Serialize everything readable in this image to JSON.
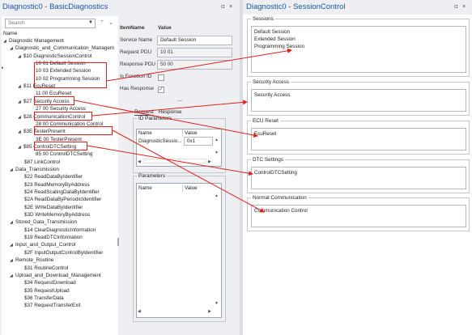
{
  "left_window": {
    "title": "Diagnostic0 - BasicDiagnostics",
    "pin_icon": "pin-icon",
    "close_icon": "×",
    "search": {
      "placeholder": "Search"
    },
    "tree_header": "Name",
    "tree": [
      {
        "label": "Diagnostic Management",
        "level": 0,
        "expander": "◢"
      },
      {
        "label": "Diagnostic_and_Communication_Managem",
        "level": 1,
        "expander": "◢"
      },
      {
        "label": "$10 DiagnosticSessionControl",
        "level": 2,
        "expander": "◢"
      },
      {
        "label": "10 01 Default Session",
        "level": 3,
        "expander": ""
      },
      {
        "label": "10 03 Extended Session",
        "level": 3,
        "expander": ""
      },
      {
        "label": "10 02 Programming Session",
        "level": 3,
        "expander": ""
      },
      {
        "label": "$11 EcuReset",
        "level": 2,
        "expander": "◢"
      },
      {
        "label": "11 00 EcuReset",
        "level": 3,
        "expander": ""
      },
      {
        "label": "$27 Security Access",
        "level": 2,
        "expander": "◢"
      },
      {
        "label": "27 00 Security Access",
        "level": 3,
        "expander": ""
      },
      {
        "label": "$28 CommunicationControl",
        "level": 2,
        "expander": "◢"
      },
      {
        "label": "28 00 Communication Control",
        "level": 3,
        "expander": ""
      },
      {
        "label": "$3E TesterPresent",
        "level": 2,
        "expander": "◢"
      },
      {
        "label": "3E 00 TesterPresent",
        "level": 3,
        "expander": ""
      },
      {
        "label": "$85 ControlDTCSetting",
        "level": 2,
        "expander": "◢"
      },
      {
        "label": "85 00 ControlDTCSetting",
        "level": 3,
        "expander": ""
      },
      {
        "label": "$87 LinkControl",
        "level": 2,
        "expander": ""
      },
      {
        "label": "Data_Transmission",
        "level": 1,
        "expander": "◢"
      },
      {
        "label": "$22 ReadDataByIdentifier",
        "level": 2,
        "expander": ""
      },
      {
        "label": "$23 ReadMemoryByAddress",
        "level": 2,
        "expander": ""
      },
      {
        "label": "$24 ReadScalingDataByIdentifier",
        "level": 2,
        "expander": ""
      },
      {
        "label": "$2A ReadDataByPeriodicIdentifier",
        "level": 2,
        "expander": ""
      },
      {
        "label": "$2E WriteDataByIdentifier",
        "level": 2,
        "expander": ""
      },
      {
        "label": "$3D WriteMemoryByAddress",
        "level": 2,
        "expander": ""
      },
      {
        "label": "Stored_Data_Transmission",
        "level": 1,
        "expander": "◢"
      },
      {
        "label": "$14 ClearDiagnosticInformation",
        "level": 2,
        "expander": ""
      },
      {
        "label": "$19 ReadDTCInformation",
        "level": 2,
        "expander": ""
      },
      {
        "label": "Input_and_Output_Control",
        "level": 1,
        "expander": "◢"
      },
      {
        "label": "$2F InputOutputControlByIdentifier",
        "level": 2,
        "expander": ""
      },
      {
        "label": "Remote_Routine",
        "level": 1,
        "expander": "◢"
      },
      {
        "label": "$31 RoutineControl",
        "level": 2,
        "expander": ""
      },
      {
        "label": "Upload_and_Download_Management",
        "level": 1,
        "expander": "◢"
      },
      {
        "label": "$34 RequestDownload",
        "level": 2,
        "expander": ""
      },
      {
        "label": "$35 RequestUpload",
        "level": 2,
        "expander": ""
      },
      {
        "label": "$36 TransferData",
        "level": 2,
        "expander": ""
      },
      {
        "label": "$37 RequestTransferExit",
        "level": 2,
        "expander": ""
      }
    ],
    "props": {
      "col_itemname": "ItemName",
      "col_value": "Value",
      "service_name_label": "Service Name",
      "service_name_value": "Default Session",
      "request_pdu_label": "Request PDU",
      "request_pdu_value": "10 01",
      "response_pdu_label": "Response PDU",
      "response_pdu_value": "50 00",
      "is_function_id_label": "Is Function ID",
      "is_function_id_checked": false,
      "has_response_label": "Has Response",
      "has_response_checked": true,
      "dash": "—",
      "tab_request": "Request",
      "tab_response": "Response",
      "id_params_legend": "ID Parameters",
      "id_params_col_name": "Name",
      "id_params_col_value": "Value",
      "id_params_row_name": "DiagnosticSessio...",
      "id_params_row_value": "0x1",
      "params_legend": "Parameters",
      "params_col_name": "Name",
      "params_col_value": "Value"
    }
  },
  "right_window": {
    "title": "Diagnostic0 - SessionControl",
    "pin_icon": "pin-icon",
    "close_icon": "×",
    "groups": [
      {
        "legend": "Sessions",
        "items": [
          "Default Session",
          "Extended Session",
          "Programming Session"
        ]
      },
      {
        "legend": "Security Access",
        "items": [
          "Security Access"
        ]
      },
      {
        "legend": "ECU Reset",
        "items": [
          "EcuReset"
        ]
      },
      {
        "legend": "DTC Settings",
        "items": [
          "ControlDTCSetting"
        ]
      },
      {
        "legend": "Normal Communication",
        "items": [
          "Communication Control"
        ]
      }
    ]
  },
  "annotation_color": "#e0201c",
  "accent_color": "#1a57a8"
}
